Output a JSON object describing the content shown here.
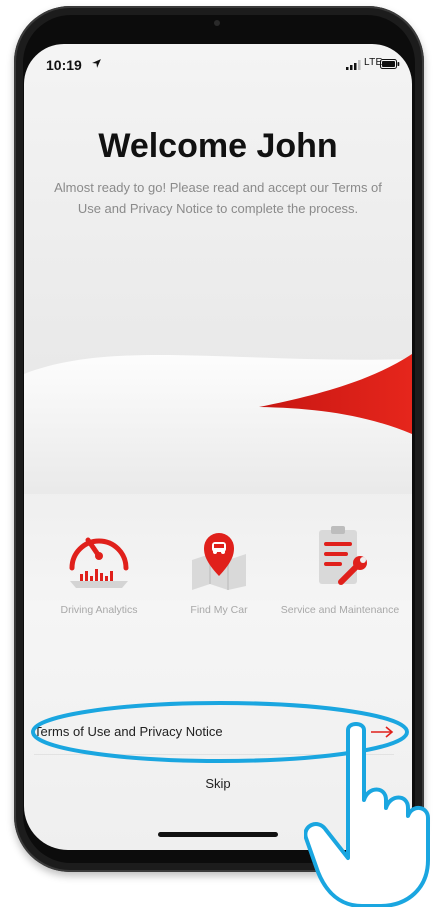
{
  "status_bar": {
    "time": "10:19",
    "network": "LTE"
  },
  "welcome": {
    "title": "Welcome John",
    "message": "Almost ready to go! Please read and accept our Terms of Use and Privacy Notice to complete the process."
  },
  "features": [
    {
      "label": "Driving Analytics",
      "icon": "speedometer-icon"
    },
    {
      "label": "Find My Car",
      "icon": "map-pin-car-icon"
    },
    {
      "label": "Service and Maintenance",
      "icon": "clipboard-wrench-icon"
    }
  ],
  "terms_link": {
    "label": "Terms of Use and Privacy Notice",
    "icon": "arrow-right-icon"
  },
  "skip_label": "Skip",
  "colors": {
    "accent": "#e0201b",
    "highlight": "#1aa6e0",
    "text_muted": "#8a8a8a"
  }
}
